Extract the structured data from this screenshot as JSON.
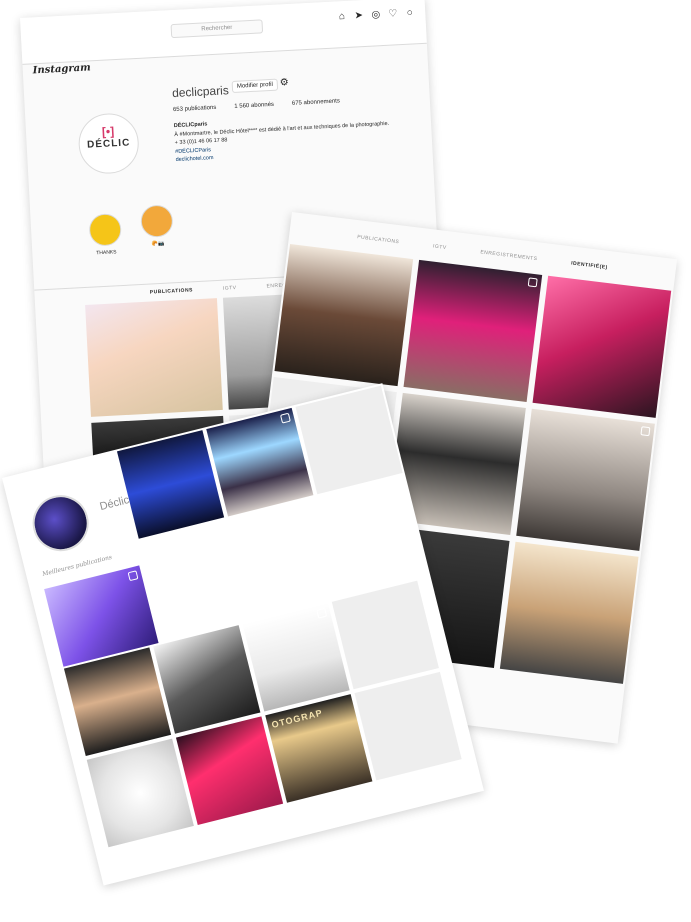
{
  "profile_page": {
    "app_logo": "Instagram",
    "search": {
      "placeholder": "Rechercher"
    },
    "nav_icons": [
      "home-icon",
      "direct-icon",
      "explore-icon",
      "heart-icon",
      "profile-icon"
    ],
    "username": "declicparis",
    "edit_profile_label": "Modifier profil",
    "avatar_text": "DÉCLIC",
    "stats": {
      "posts": "653 publications",
      "followers": "1 560 abonnés",
      "following": "675 abonnements"
    },
    "bio": {
      "name": "DÉCLICparis",
      "line1": "À #Montmartre, le Déclic Hôtel**** est dédié à l'art et aux techniques de la photographie.",
      "phone": "+ 33 (0)1 46 06 17 88",
      "hashtag": "#DÉCLICParis",
      "website": "declichotel.com"
    },
    "highlights": [
      {
        "label": "THANKS",
        "color": "#f5c518"
      },
      {
        "label": "🥐📷",
        "color": "#f2a83b"
      }
    ],
    "tabs": [
      "PUBLICATIONS",
      "IGTV",
      "ENREGISTREMENTS"
    ],
    "active_tab": "PUBLICATIONS"
  },
  "tagged_page": {
    "tabs": [
      "PUBLICATIONS",
      "IGTV",
      "ENREGISTREMENTS",
      "IDENTIFIÉ(E)"
    ],
    "active_tab": "IDENTIFIÉ(E)"
  },
  "hotel_page": {
    "name": "Déclic Hôtel",
    "best_posts_label": "Meilleures publications",
    "sign_text": "OTOGRAP"
  },
  "colors": {
    "accent_pink": "#d63a6a",
    "link_blue": "#00376b",
    "border": "#dbdbdb"
  }
}
